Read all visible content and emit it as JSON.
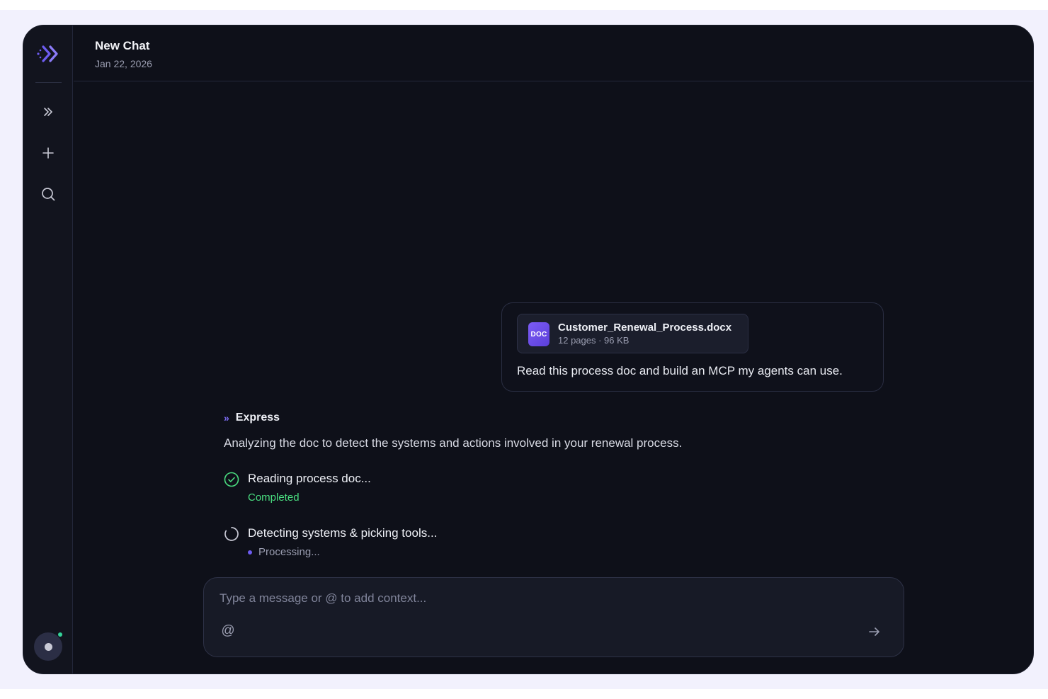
{
  "sidebar": {
    "logo_icon": "express-logo-icon",
    "items": [
      {
        "icon": "chevrons-right-icon",
        "name": "expand-sidebar-button"
      },
      {
        "icon": "plus-icon",
        "name": "new-chat-button"
      },
      {
        "icon": "search-icon",
        "name": "search-button"
      }
    ],
    "accent_color": "#7c6cf2",
    "status_color": "#34d399"
  },
  "header": {
    "title": "New Chat",
    "date": "Jan 22, 2026"
  },
  "user_message": {
    "attachment": {
      "type_label": "DOC",
      "file_name": "Customer_Renewal_Process.docx",
      "meta": "12 pages · 96 KB"
    },
    "text": "Read this process doc and build an MCP my agents can use."
  },
  "assistant": {
    "mark": "»",
    "name": "Express",
    "text": "Analyzing the doc to detect the systems and actions involved in your renewal process.",
    "steps": [
      {
        "title": "Reading process doc...",
        "status": "Completed",
        "state": "done"
      },
      {
        "title": "Detecting systems & picking tools...",
        "status": "Processing...",
        "state": "running"
      }
    ]
  },
  "composer": {
    "placeholder": "Type a message or @ to add context...",
    "value": "",
    "mention_symbol": "@",
    "send_icon": "arrow-right-icon"
  }
}
